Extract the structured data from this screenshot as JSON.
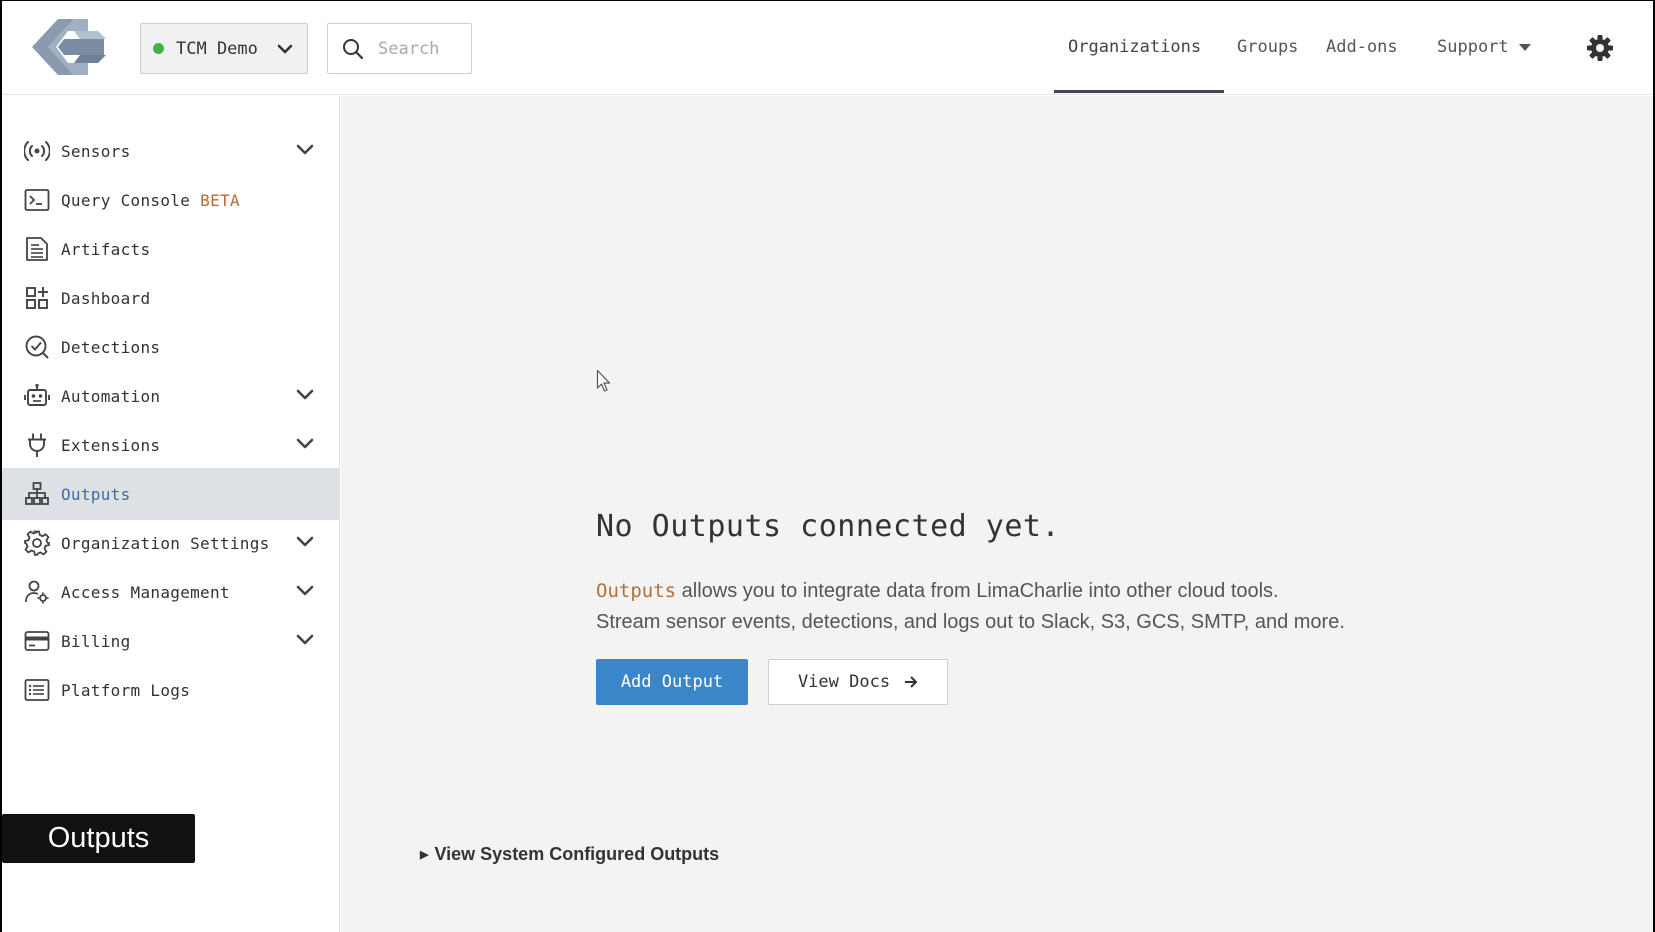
{
  "org": {
    "name": "TCM Demo",
    "status_color": "#3bb54a"
  },
  "search": {
    "placeholder": "Search"
  },
  "topnav": {
    "items": [
      {
        "label": "Organizations"
      },
      {
        "label": "Groups"
      },
      {
        "label": "Add-ons"
      },
      {
        "label": "Support"
      }
    ],
    "active": "Organizations"
  },
  "sidebar": {
    "items": [
      {
        "label": "Sensors",
        "icon": "broadcast-icon",
        "expandable": true
      },
      {
        "label": "Query Console",
        "badge": "BETA",
        "icon": "terminal-icon",
        "expandable": false
      },
      {
        "label": "Artifacts",
        "icon": "document-lines-icon",
        "expandable": false
      },
      {
        "label": "Dashboard",
        "icon": "grid-plus-icon",
        "expandable": false
      },
      {
        "label": "Detections",
        "icon": "check-circle-icon",
        "expandable": false
      },
      {
        "label": "Automation",
        "icon": "robot-icon",
        "expandable": true
      },
      {
        "label": "Extensions",
        "icon": "plug-icon",
        "expandable": true
      },
      {
        "label": "Outputs",
        "icon": "hierarchy-icon",
        "expandable": false,
        "active": true
      },
      {
        "label": "Organization Settings",
        "icon": "gear-icon",
        "expandable": true
      },
      {
        "label": "Access Management",
        "icon": "user-gear-icon",
        "expandable": true
      },
      {
        "label": "Billing",
        "icon": "credit-card-icon",
        "expandable": true
      },
      {
        "label": "Platform Logs",
        "icon": "list-icon",
        "expandable": false
      }
    ]
  },
  "tooltip": {
    "text": "Outputs"
  },
  "main": {
    "empty_title": "No Outputs connected yet.",
    "desc_keyword": "Outputs",
    "desc_line1_rest": " allows you to integrate data from LimaCharlie into other cloud tools.",
    "desc_line2": "Stream sensor events, detections, and logs out to Slack, S3, GCS, SMTP, and more.",
    "add_button": "Add Output",
    "docs_button": "View Docs",
    "system_outputs_link": "View System Configured Outputs"
  },
  "colors": {
    "accent": "#3a86c8",
    "keyword": "#b4703a",
    "active_bg": "#dde0e5"
  }
}
